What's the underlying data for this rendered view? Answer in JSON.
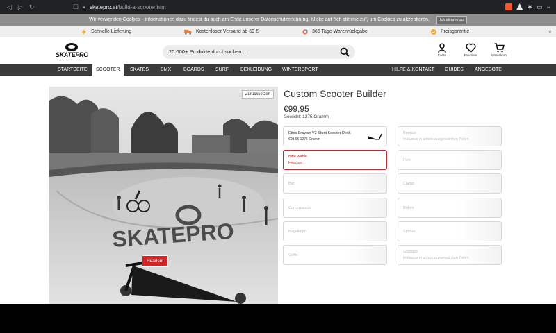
{
  "browser": {
    "url_domain": "skatepro.at",
    "url_path": "/build-a-scooter.htm",
    "brave_badge": "8"
  },
  "cookie_bar": {
    "text_before": "Wir verwenden ",
    "link_text": "Cookies",
    "text_after": " - Informationen dazu findest du auch am Ende unserer Datenschutzerklärung. Klicke auf \"Ich stimme zu\", um Cookies zu akzeptieren.",
    "accept_label": "Ich stimme zu"
  },
  "usp": {
    "items": [
      {
        "label": "Schnelle Lieferung",
        "icon": "lightning-icon",
        "color": "#f5a623"
      },
      {
        "label": "Kostenloser Versand ab 69 €",
        "icon": "truck-icon",
        "color": "#e8772e"
      },
      {
        "label": "365 Tage Warenrückgabe",
        "icon": "return-icon",
        "color": "#e85a2e"
      },
      {
        "label": "Preisgarantie",
        "icon": "badge-check-icon",
        "color": "#f5a623"
      }
    ],
    "close": "×"
  },
  "header": {
    "logo_text": "SKATEPRO",
    "search_placeholder": "20.000+ Produkte durchsuchen...",
    "icons": [
      {
        "label": "Konto",
        "icon": "user-icon"
      },
      {
        "label": "Favoriten",
        "icon": "heart-icon"
      },
      {
        "label": "Warenkorb",
        "icon": "cart-icon"
      }
    ]
  },
  "nav": {
    "left": [
      "STARTSEITE",
      "SCOOTER",
      "SKATES",
      "BMX",
      "BOARDS",
      "SURF",
      "BEKLEIDUNG",
      "WINTERSPORT"
    ],
    "right": [
      "HILFE & KONTAKT",
      "GUIDES",
      "ANGEBOTE"
    ],
    "active": "SCOOTER"
  },
  "builder": {
    "reset_label": "Zurücksetzen",
    "title": "Custom Scooter Builder",
    "price": "€99,95",
    "weight": "Gewicht: 1275 Gramm",
    "photo_tag": "Headset",
    "parts": [
      {
        "name": "Ethic Erawan V2 Stunt Scooter Deck",
        "sub": "€99,95      1275 Gramm",
        "state": "filled"
      },
      {
        "name": "Bremse",
        "sub": "Inklusive in schon ausgewählten Teilen",
        "state": "empty"
      },
      {
        "name": "Bitte wähle",
        "sub": "Headset",
        "state": "error"
      },
      {
        "name": "Fork",
        "sub": "",
        "state": "empty"
      },
      {
        "name": "Bar",
        "sub": "",
        "state": "empty"
      },
      {
        "name": "Clamp",
        "sub": "",
        "state": "empty"
      },
      {
        "name": "Compression",
        "sub": "",
        "state": "empty"
      },
      {
        "name": "Rollen",
        "sub": "",
        "state": "empty"
      },
      {
        "name": "Kugellager",
        "sub": "",
        "state": "empty"
      },
      {
        "name": "Spacer",
        "sub": "",
        "state": "empty"
      },
      {
        "name": "Griffe",
        "sub": "",
        "state": "empty"
      },
      {
        "name": "Griptape",
        "sub": "Inklusive in schon ausgewählten Teilen",
        "state": "empty"
      }
    ]
  },
  "colors": {
    "accent_red": "#d02428",
    "nav_bg": "#3a3a3a",
    "cookie_bg": "#8e8e8e"
  }
}
